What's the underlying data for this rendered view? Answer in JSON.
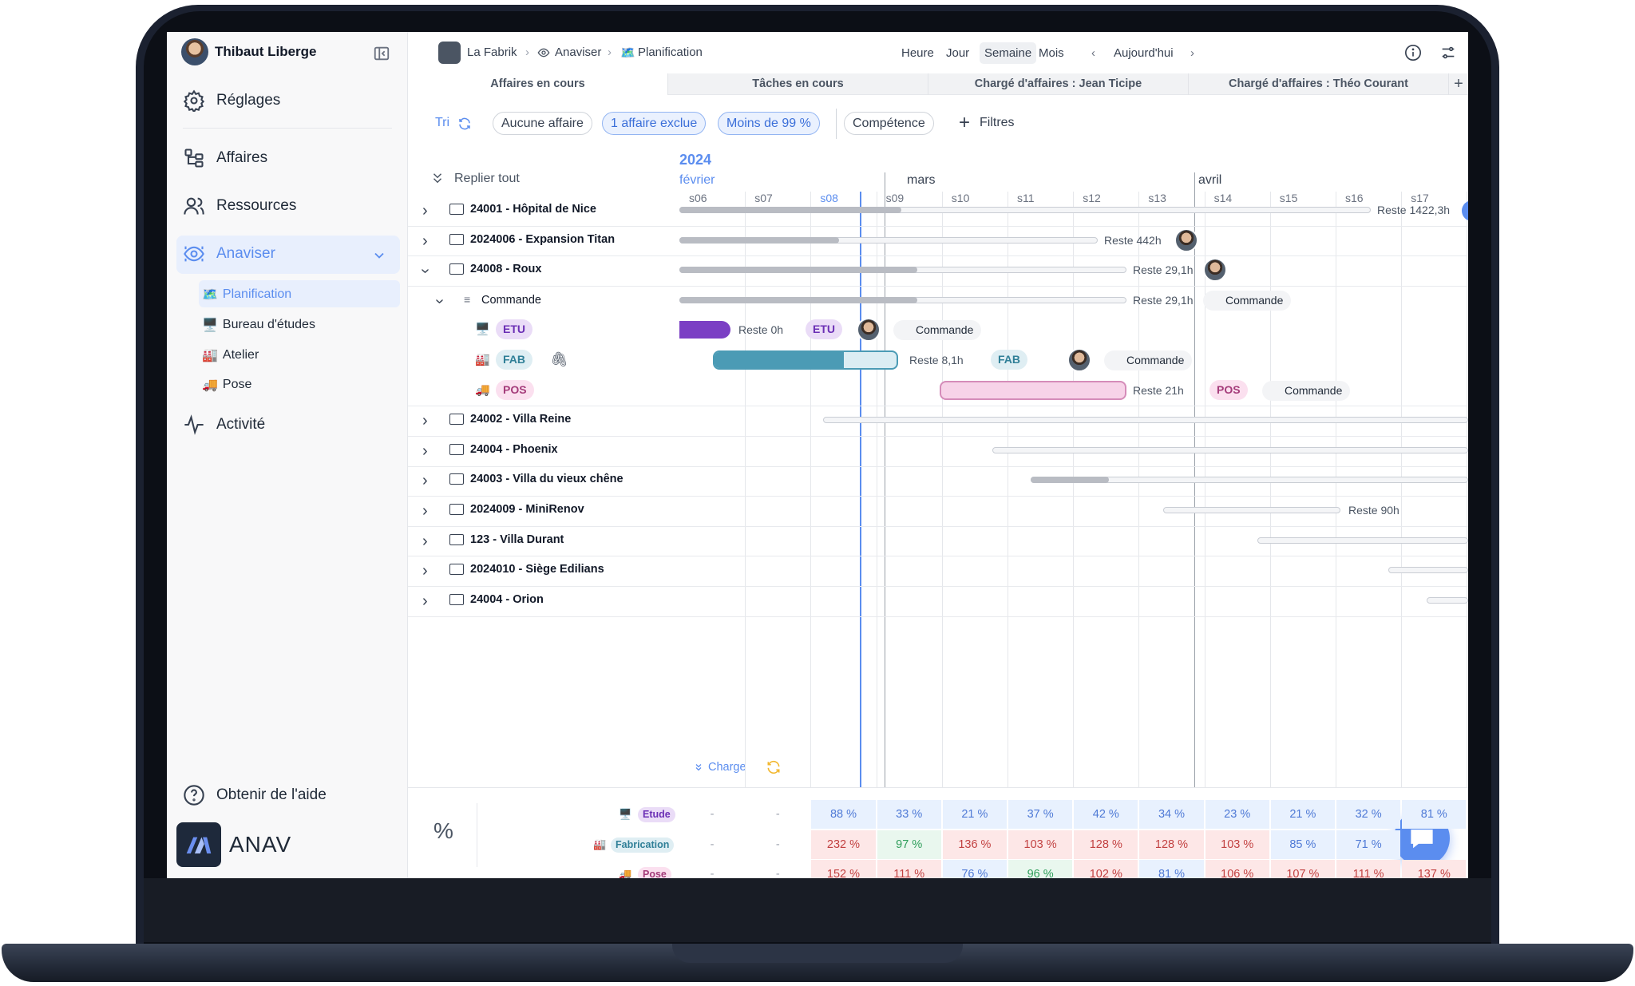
{
  "user": {
    "name": "Thibaut Liberge"
  },
  "sidebar": {
    "items": [
      {
        "label": "Réglages",
        "icon": "gear-icon"
      },
      {
        "label": "Affaires",
        "icon": "tree-icon"
      },
      {
        "label": "Ressources",
        "icon": "users-icon"
      },
      {
        "label": "Anaviser",
        "icon": "eye-icon"
      },
      {
        "label": "Activité",
        "icon": "activity-icon"
      }
    ],
    "subitems": [
      {
        "emoji": "🗺️",
        "label": "Planification"
      },
      {
        "emoji": "🖥️",
        "label": "Bureau d'études"
      },
      {
        "emoji": "🏭",
        "label": "Atelier"
      },
      {
        "emoji": "🚚",
        "label": "Pose"
      }
    ],
    "help": "Obtenir de l'aide",
    "brand": "ANAV"
  },
  "breadcrumb": {
    "org": "La Fabrik",
    "section": "Anaviser",
    "page": "Planification",
    "page_emoji": "🗺️"
  },
  "view": {
    "modes": [
      "Heure",
      "Jour",
      "Semaine",
      "Mois"
    ],
    "active": "Semaine",
    "today": "Aujourd'hui"
  },
  "tabs": [
    "Affaires en cours",
    "Tâches en cours",
    "Chargé d'affaires : Jean Ticipe",
    "Chargé d'affaires : Théo Courant"
  ],
  "filters": {
    "sort": "Tri",
    "chips": [
      "Aucune affaire",
      "1 affaire exclue",
      "Moins de 99 %",
      "Compétence"
    ],
    "more": "Filtres"
  },
  "tree": {
    "collapse_all": "Replier tout",
    "rows": [
      {
        "label": "24001 - Hôpital de Nice"
      },
      {
        "label": "2024006 - Expansion Titan"
      },
      {
        "label": "24008 - Roux"
      },
      {
        "label": "Commande"
      },
      {
        "tag": "ETU",
        "emoji": "🖥️"
      },
      {
        "tag": "FAB",
        "emoji": "🏭"
      },
      {
        "tag": "POS",
        "emoji": "🚚"
      },
      {
        "label": "24002 - Villa Reine"
      },
      {
        "label": "24004 - Phoenix"
      },
      {
        "label": "24003 - Villa du vieux chêne"
      },
      {
        "label": "2024009 - MiniRenov"
      },
      {
        "label": "123 - Villa Durant"
      },
      {
        "label": "2024010 - Siège Edilians"
      },
      {
        "label": "24004 - Orion"
      }
    ]
  },
  "timeline": {
    "year": "2024",
    "months": [
      "février",
      "mars",
      "avril"
    ],
    "weeks": [
      "s06",
      "s07",
      "s08",
      "s09",
      "s10",
      "s11",
      "s12",
      "s13",
      "s14",
      "s15",
      "s16",
      "s17"
    ],
    "current_week": "s08"
  },
  "gantt": {
    "labels": [
      "Reste 1422,3h",
      "Reste 442h",
      "Reste 29,1h",
      "Reste 29,1h",
      "Reste 0h",
      "Reste 8,1h",
      "Reste 21h",
      "Reste 90h"
    ],
    "commande": "Commande",
    "tags": {
      "etu": "ETU",
      "fab": "FAB",
      "pos": "POS"
    }
  },
  "charge": {
    "label": "Charge",
    "percent_symbol": "%",
    "rows": [
      {
        "label": "Etude",
        "emoji": "🖥️",
        "values": [
          "-",
          "-",
          "88 %",
          "33 %",
          "21 %",
          "37 %",
          "42 %",
          "34 %",
          "23 %",
          "21 %",
          "32 %",
          "81 %"
        ]
      },
      {
        "label": "Fabrication",
        "emoji": "🏭",
        "values": [
          "-",
          "-",
          "232 %",
          "97 %",
          "136 %",
          "103 %",
          "128 %",
          "128 %",
          "103 %",
          "85 %",
          "71 %",
          ""
        ]
      },
      {
        "label": "Pose",
        "emoji": "🚚",
        "values": [
          "-",
          "-",
          "152 %",
          "111 %",
          "76 %",
          "96 %",
          "102 %",
          "81 %",
          "106 %",
          "107 %",
          "111 %",
          "137 %"
        ]
      }
    ]
  },
  "colors": {
    "accent": "#5b8def",
    "etu": "#7b3fc4",
    "fab": "#4b9bb5",
    "pos": "#e7b6d6",
    "over": "#fde7e7",
    "under": "#e8f1fe",
    "ok": "#e9f7ee"
  }
}
